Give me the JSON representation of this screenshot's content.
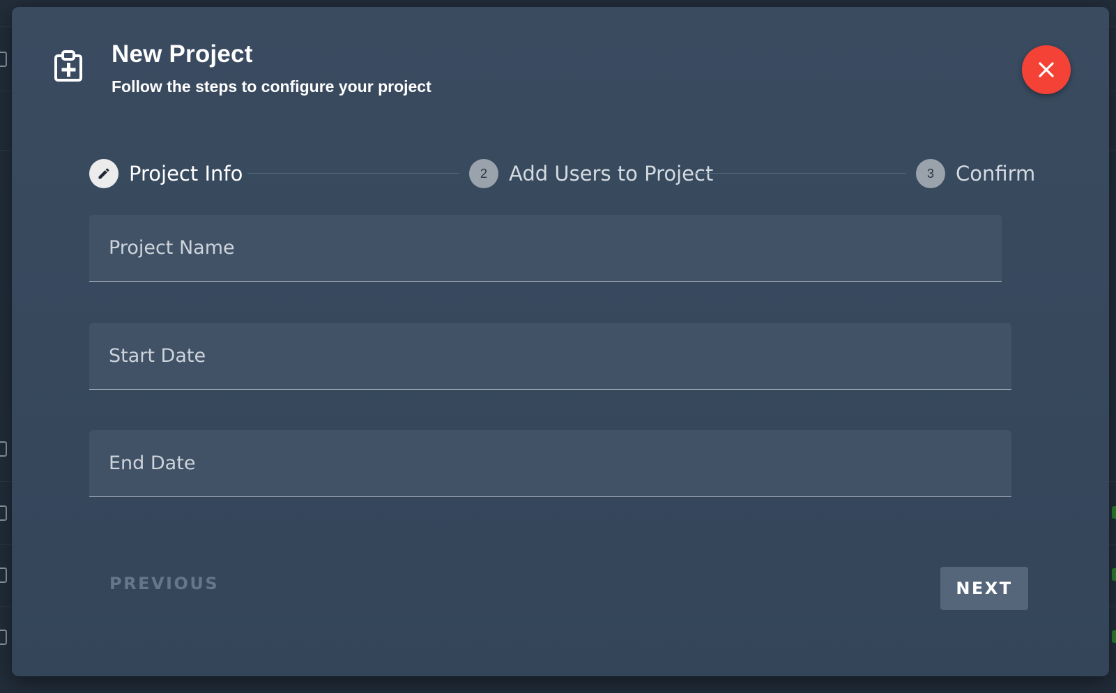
{
  "dialog": {
    "title": "New Project",
    "subtitle": "Follow the steps to configure your project",
    "header_icon": "clipboard-plus-icon",
    "close_icon": "close-icon",
    "close_color": "#f44336"
  },
  "stepper": {
    "steps": [
      {
        "label": "Project Info",
        "marker": "",
        "icon": "pencil-icon",
        "state": "active"
      },
      {
        "label": "Add Users to Project",
        "marker": "2",
        "state": "pending"
      },
      {
        "label": "Confirm",
        "marker": "3",
        "state": "pending"
      }
    ]
  },
  "form": {
    "project_name": {
      "value": "",
      "placeholder": "Project Name"
    },
    "start_date": {
      "value": "",
      "placeholder": "Start Date"
    },
    "end_date": {
      "value": "",
      "placeholder": "End Date"
    }
  },
  "actions": {
    "previous_label": "PREVIOUS",
    "previous_disabled": true,
    "next_label": "NEXT"
  }
}
